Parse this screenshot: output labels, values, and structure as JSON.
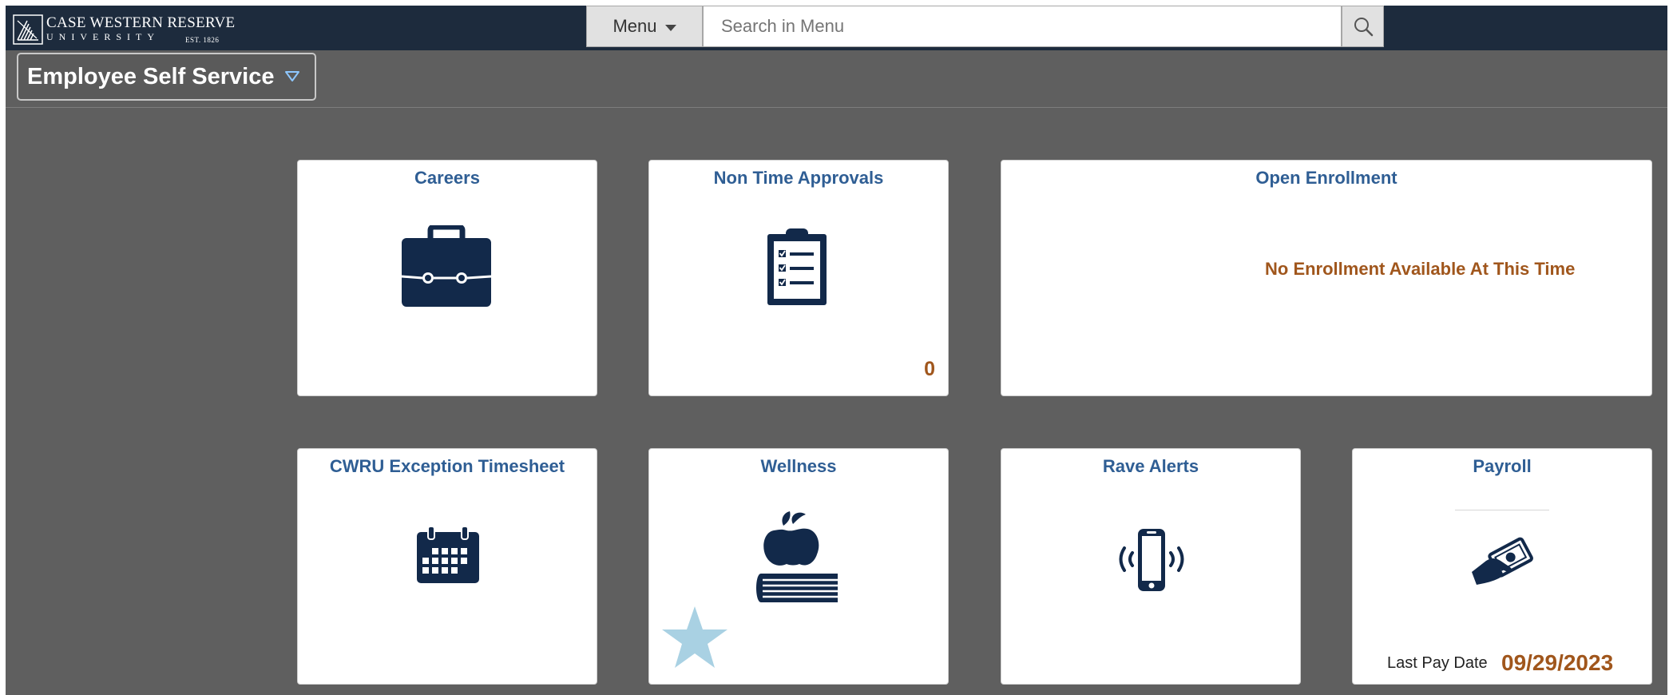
{
  "header": {
    "logo": {
      "line1": "CASE WESTERN RESERVE",
      "line2": "UNIVERSITY",
      "est": "EST. 1826"
    },
    "menu_label": "Menu",
    "search_placeholder": "Search in Menu"
  },
  "homepage": {
    "title": "Employee Self Service"
  },
  "tiles": [
    {
      "title": "Careers",
      "icon": "briefcase-icon"
    },
    {
      "title": "Non Time Approvals",
      "icon": "clipboard-checklist-icon",
      "count": "0"
    },
    {
      "title": "Open Enrollment",
      "message": "No Enrollment Available At This Time"
    },
    {
      "title": "CWRU Exception Timesheet",
      "icon": "calendar-icon"
    },
    {
      "title": "Wellness",
      "icon": "apple-on-book-icon"
    },
    {
      "title": "Rave Alerts",
      "icon": "vibrating-phone-icon"
    },
    {
      "title": "Payroll",
      "icon": "hand-with-money-icon",
      "last_pay_label": "Last Pay Date",
      "last_pay_date": "09/29/2023"
    }
  ],
  "colors": {
    "banner": "#1d2b3d",
    "background": "#5f5f5f",
    "tile_title": "#2f5e94",
    "icon": "#12294a",
    "accent": "#a0561c",
    "star": "#a9d1e3"
  }
}
